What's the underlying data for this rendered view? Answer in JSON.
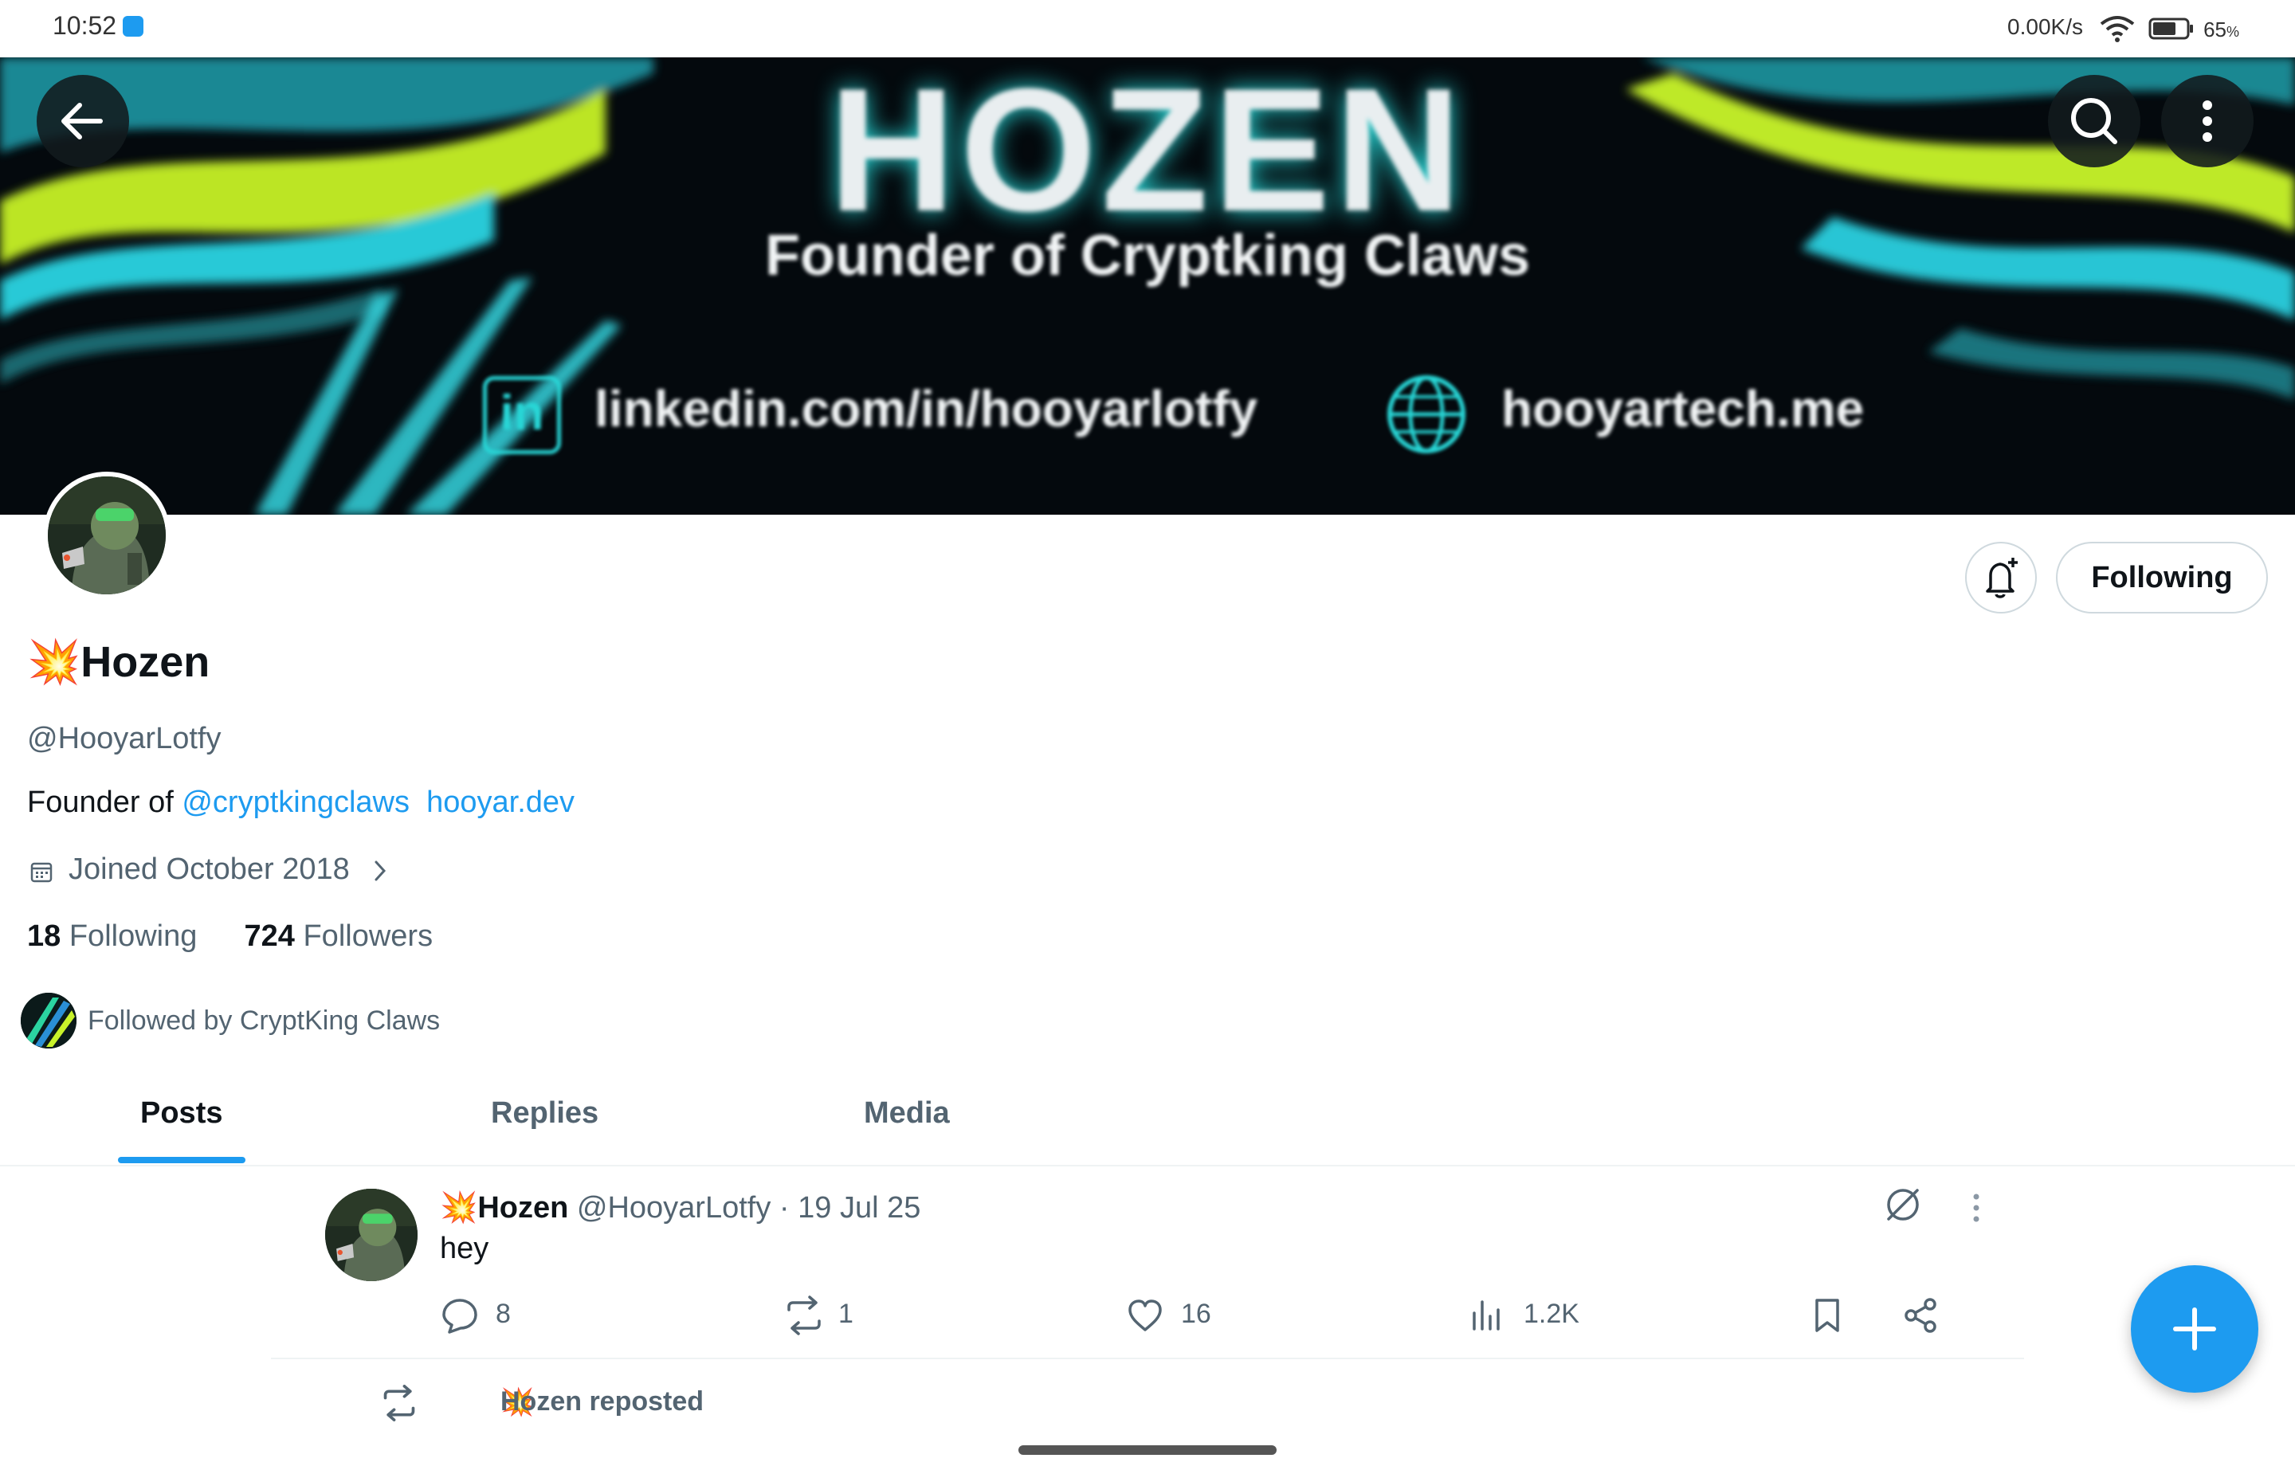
{
  "status_bar": {
    "time": "10:52",
    "network_speed": "0.00K/s",
    "battery": "65",
    "battery_unit": "%"
  },
  "banner": {
    "title": "HOZEN",
    "subtitle": "Founder of Cryptking Claws",
    "linkedin_text": "linkedin.com/in/hooyarlotfy",
    "linkedin_icon_text": "in",
    "website_text": "hooyartech.me"
  },
  "profile": {
    "name_emoji": "💥",
    "name": "Hozen",
    "handle": "@HooyarLotfy",
    "bio_prefix": "Founder of ",
    "bio_mention": "@cryptkingclaws",
    "bio_link": "hooyar.dev",
    "joined": "Joined October 2018",
    "following_count": "18",
    "following_label": "Following",
    "followers_count": "724",
    "followers_label": "Followers",
    "followed_by": "Followed by CryptKing Claws",
    "following_button": "Following"
  },
  "tabs": [
    {
      "label": "Posts",
      "active": true
    },
    {
      "label": "Replies",
      "active": false
    },
    {
      "label": "Media",
      "active": false
    }
  ],
  "post": {
    "author_emoji": "💥",
    "author": "Hozen",
    "handle": "@HooyarLotfy",
    "separator": "·",
    "date": "19 Jul 25",
    "text": "hey",
    "replies": "8",
    "reposts": "1",
    "likes": "16",
    "views": "1.2K"
  },
  "repost_notice": {
    "emoji": "💥",
    "text": "Hozen reposted"
  },
  "colors": {
    "accent": "#1d9bf0",
    "text_primary": "#0f1419",
    "text_secondary": "#536471",
    "border": "#cfd9de"
  },
  "icons": [
    "back-arrow-icon",
    "search-icon",
    "more-vertical-icon",
    "bell-plus-icon",
    "calendar-icon",
    "chevron-right-icon",
    "grok-icon",
    "more-vertical-icon",
    "reply-icon",
    "repost-icon",
    "like-icon",
    "views-icon",
    "bookmark-icon",
    "share-icon",
    "plus-icon"
  ]
}
